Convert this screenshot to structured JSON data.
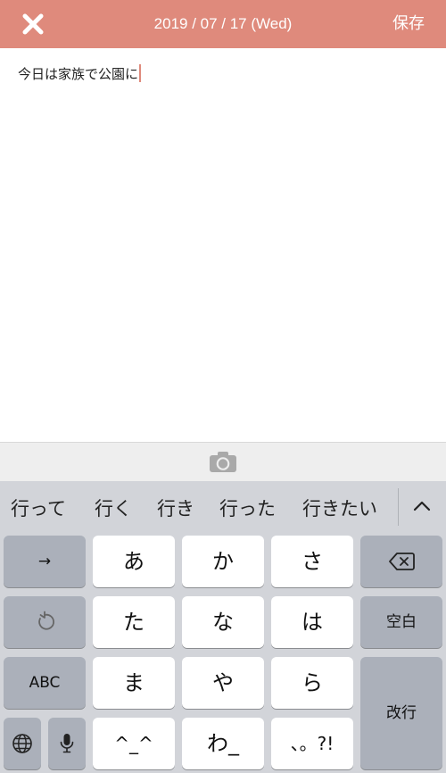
{
  "header": {
    "date": "2019 / 07 / 17 (Wed)",
    "save_label": "保存",
    "close_icon": "close-icon",
    "background": "#df8a7c"
  },
  "editor": {
    "text": "今日は家族で公園に",
    "caret_color": "#df8a7c"
  },
  "photo_bar": {
    "icon": "camera-icon"
  },
  "suggestions": {
    "items": [
      "行って",
      "行く",
      "行き",
      "行った",
      "行きたい"
    ],
    "toggle_icon": "chevron-up-icon"
  },
  "keyboard": {
    "rows": [
      {
        "left_key": "→",
        "kana": [
          "あ",
          "か",
          "さ"
        ],
        "right_key_icon": "backspace-icon"
      },
      {
        "left_key_icon": "undo-icon",
        "kana": [
          "た",
          "な",
          "は"
        ],
        "right_key": "空白"
      },
      {
        "left_key": "ABC",
        "kana": [
          "ま",
          "や",
          "ら"
        ],
        "right_key": "改行"
      },
      {
        "left_key_icons": [
          "globe-icon",
          "microphone-icon"
        ],
        "kana": [
          "^_^",
          "わ_",
          "、。?!"
        ]
      }
    ]
  }
}
